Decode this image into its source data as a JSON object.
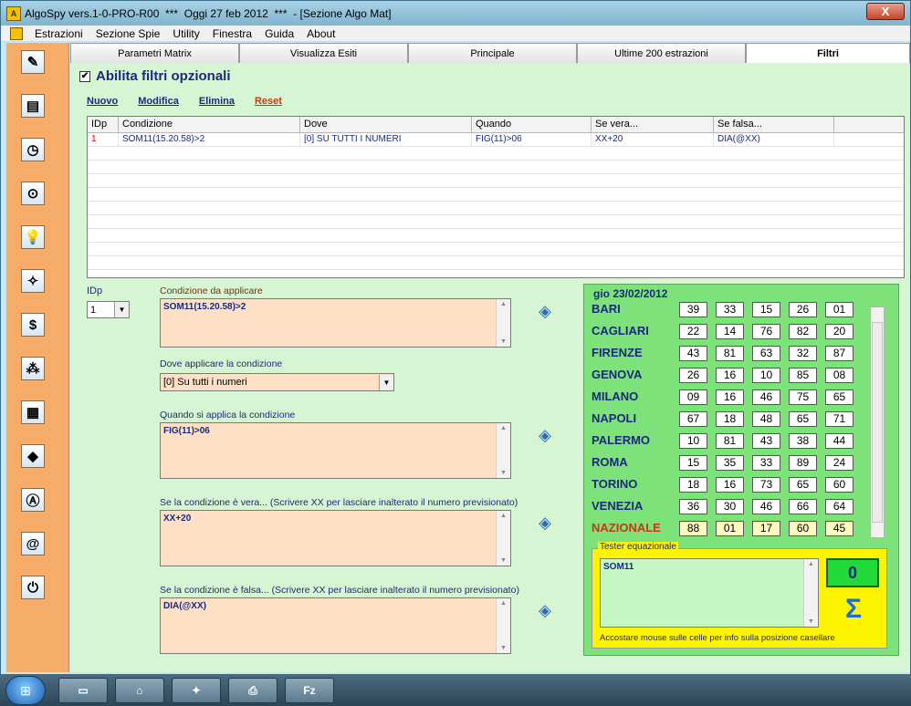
{
  "window": {
    "title": "AlgoSpy vers.1-0-PRO-R00  ***  Oggi 27 feb 2012  ***  - [Sezione Algo Mat]",
    "close_label": "X"
  },
  "menu": [
    "Estrazioni",
    "Sezione Spie",
    "Utility",
    "Finestra",
    "Guida",
    "About"
  ],
  "sidebar": [
    {
      "icon": "pencil-icon",
      "glyph": "✎"
    },
    {
      "icon": "notebook-icon",
      "glyph": "▤"
    },
    {
      "icon": "clock-icon",
      "glyph": "◷"
    },
    {
      "icon": "binoculars-icon",
      "glyph": "⊙"
    },
    {
      "icon": "lightbulb-icon",
      "glyph": "💡"
    },
    {
      "icon": "juggler-icon",
      "glyph": "✧"
    },
    {
      "icon": "dollar-icon",
      "glyph": "$"
    },
    {
      "icon": "balls-icon",
      "glyph": "⁂"
    },
    {
      "icon": "calendar-icon",
      "glyph": "▦"
    },
    {
      "icon": "shape-icon",
      "glyph": "◆"
    },
    {
      "icon": "letter-a-icon",
      "glyph": "Ⓐ"
    },
    {
      "icon": "address-book-icon",
      "glyph": "@"
    },
    {
      "icon": "power-icon",
      "glyph": "⏻"
    }
  ],
  "tabs": [
    {
      "label": "Parametri Matrix",
      "active": false
    },
    {
      "label": "Visualizza Esiti",
      "active": false
    },
    {
      "label": "Principale",
      "active": false
    },
    {
      "label": "Ultime 200 estrazioni",
      "active": false
    },
    {
      "label": "Filtri",
      "active": true
    }
  ],
  "filters": {
    "enable_label": "Abilita filtri opzionali",
    "checked_mark": "✔"
  },
  "actions": {
    "new": "Nuovo",
    "edit": "Modifica",
    "delete": "Elimina",
    "reset": "Reset"
  },
  "grid": {
    "columns": [
      "IDp",
      "Condizione",
      "Dove",
      "Quando",
      "Se vera...",
      "Se falsa..."
    ],
    "rows": [
      [
        "1",
        "SOM11(15.20.58)>2",
        "[0] SU TUTTI I NUMERI",
        "FIG(11)>06",
        "XX+20",
        "DIA(@XX)"
      ]
    ]
  },
  "form": {
    "idp_label": "IDp",
    "idp_value": "1",
    "condition_label": "Condizione da applicare",
    "condition_value": "SOM11(15.20.58)>2",
    "where_label": "Dove applicare la condizione",
    "where_value": "[0] Su tutti i numeri",
    "when_label": "Quando si applica la condizione",
    "when_value": "FIG(11)>06",
    "true_label": "Se la condizione è vera... (Scrivere XX per lasciare inalterato il numero previsionato)",
    "true_value": "XX+20",
    "false_label": "Se la condizione è falsa...  (Scrivere XX per lasciare inalterato il numero previsionato)",
    "false_value": "DIA(@XX)"
  },
  "draw": {
    "date": "gio 23/02/2012",
    "cities": [
      {
        "name": "BARI",
        "nums": [
          "39",
          "33",
          "15",
          "26",
          "01"
        ]
      },
      {
        "name": "CAGLIARI",
        "nums": [
          "22",
          "14",
          "76",
          "82",
          "20"
        ]
      },
      {
        "name": "FIRENZE",
        "nums": [
          "43",
          "81",
          "63",
          "32",
          "87"
        ]
      },
      {
        "name": "GENOVA",
        "nums": [
          "26",
          "16",
          "10",
          "85",
          "08"
        ]
      },
      {
        "name": "MILANO",
        "nums": [
          "09",
          "16",
          "46",
          "75",
          "65"
        ]
      },
      {
        "name": "NAPOLI",
        "nums": [
          "67",
          "18",
          "48",
          "65",
          "71"
        ]
      },
      {
        "name": "PALERMO",
        "nums": [
          "10",
          "81",
          "43",
          "38",
          "44"
        ]
      },
      {
        "name": "ROMA",
        "nums": [
          "15",
          "35",
          "33",
          "89",
          "24"
        ]
      },
      {
        "name": "TORINO",
        "nums": [
          "18",
          "16",
          "73",
          "65",
          "60"
        ]
      },
      {
        "name": "VENEZIA",
        "nums": [
          "36",
          "30",
          "46",
          "66",
          "64"
        ]
      },
      {
        "name": "NAZIONALE",
        "nums": [
          "88",
          "01",
          "17",
          "60",
          "45"
        ]
      }
    ]
  },
  "tester": {
    "title": "Tester equazionale",
    "input": "SOM11",
    "result": "0",
    "hint": "Accostare mouse sulle celle per info sulla posizione casellare"
  },
  "taskbar": [
    {
      "icon": "explorer-icon",
      "glyph": "▭"
    },
    {
      "icon": "network-icon",
      "glyph": "⌂"
    },
    {
      "icon": "algospy-icon",
      "glyph": "✦"
    },
    {
      "icon": "printer-icon",
      "glyph": "⎙"
    },
    {
      "icon": "filezilla-icon",
      "glyph": "Fz"
    }
  ]
}
